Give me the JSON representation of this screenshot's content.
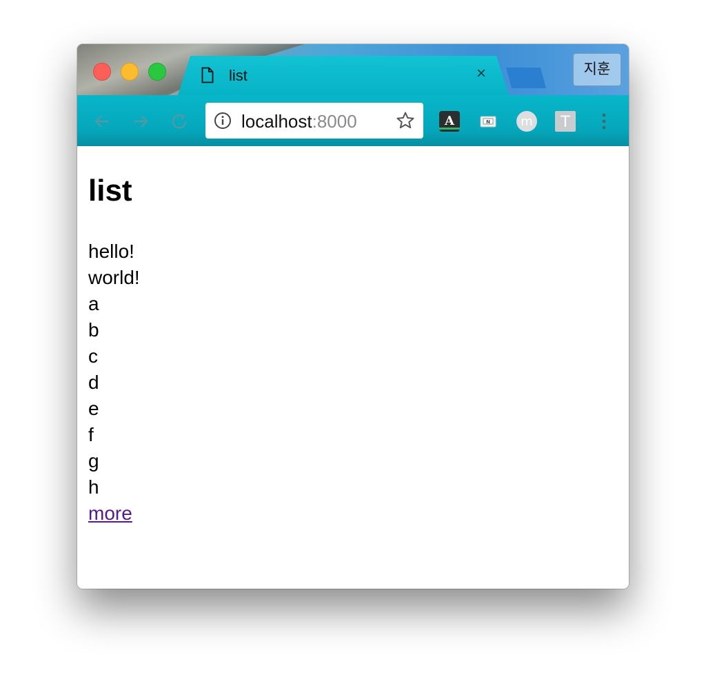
{
  "browser": {
    "tab": {
      "title": "list",
      "close_symbol": "×"
    },
    "profile_button": "지훈",
    "omnibox": {
      "host": "localhost",
      "port": ":8000"
    },
    "extensions": {
      "m_label": "m",
      "t_label": "T"
    },
    "colors": {
      "close": "#fc5f57",
      "minimize": "#fdbc2e",
      "maximize": "#28c840",
      "tab": "#06b3c5",
      "link_visited": "#551a8b"
    }
  },
  "page": {
    "heading": "list",
    "items": [
      "hello!",
      "world!",
      "a",
      "b",
      "c",
      "d",
      "e",
      "f",
      "g",
      "h"
    ],
    "more_link": "more"
  }
}
